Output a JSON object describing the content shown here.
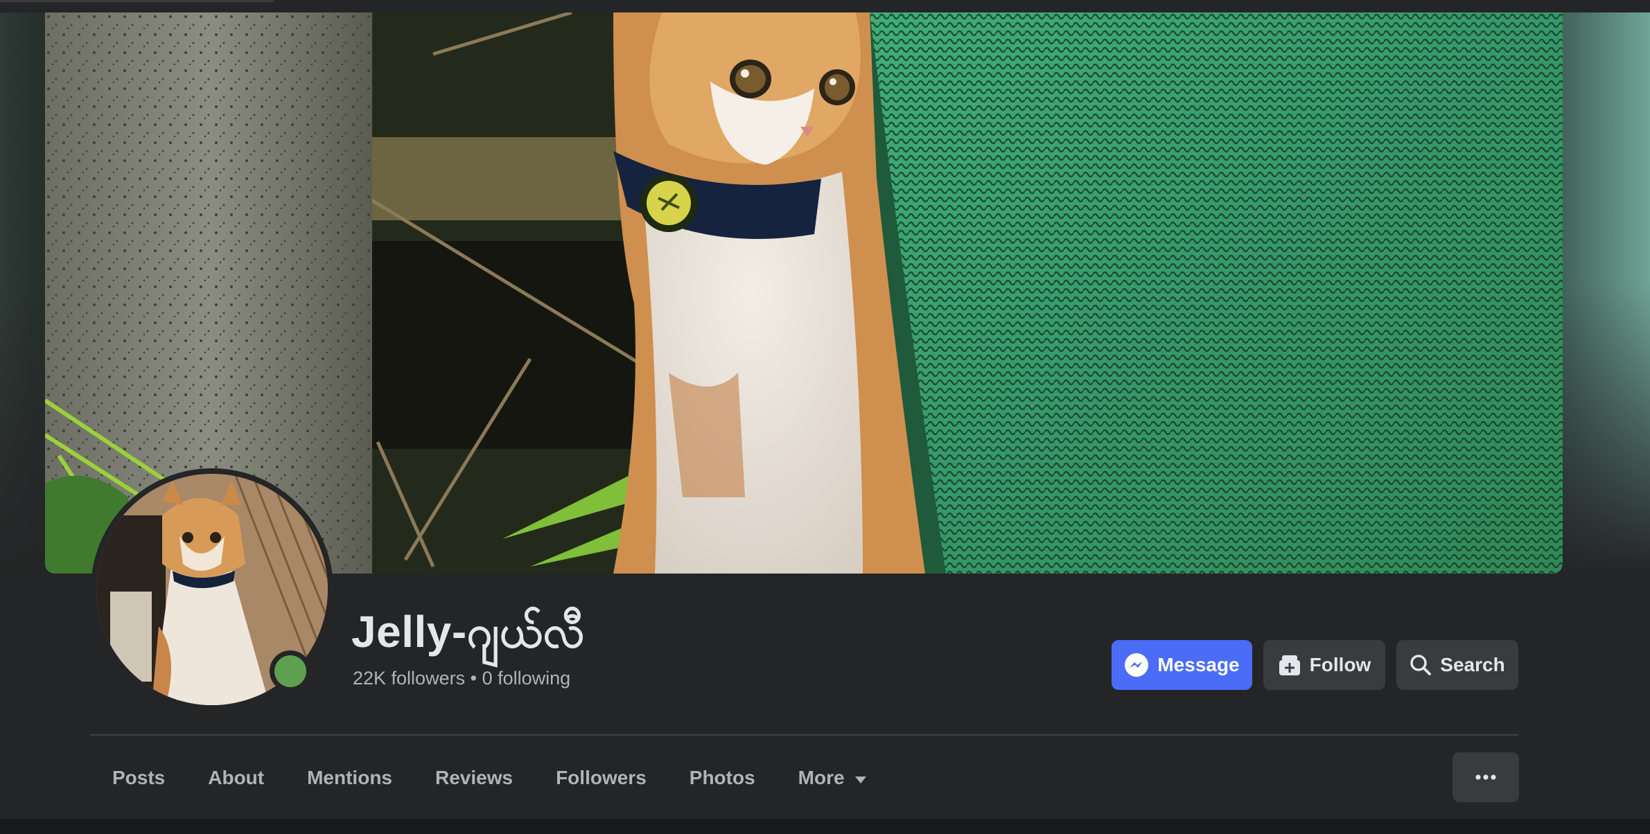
{
  "page": {
    "name": "Jelly-ဂျယ်လီ",
    "followers": "22K followers",
    "separator": "•",
    "following": "0 following"
  },
  "actions": {
    "message_label": "Message",
    "follow_label": "Follow",
    "search_label": "Search"
  },
  "tabs": [
    {
      "label": "Posts"
    },
    {
      "label": "About"
    },
    {
      "label": "Mentions"
    },
    {
      "label": "Reviews"
    },
    {
      "label": "Followers"
    },
    {
      "label": "Photos"
    },
    {
      "label": "More"
    }
  ],
  "icons": {
    "message": "messenger-icon",
    "follow": "follow-icon",
    "search": "search-icon",
    "more_tab": "caret-down-icon",
    "overflow": "ellipsis-icon"
  },
  "colors": {
    "primary_button": "#4a6cf7",
    "secondary_button": "#3a3b3c",
    "panel": "#242526",
    "online": "#5ea04f"
  }
}
